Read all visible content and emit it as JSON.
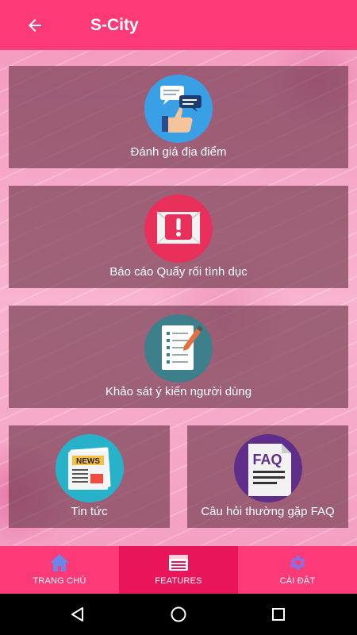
{
  "app_bar": {
    "title": "S-City"
  },
  "cards": {
    "rate": {
      "label": "Đánh giá địa điểm"
    },
    "report": {
      "label": "Báo cáo Quấy rối tình dục"
    },
    "survey": {
      "label": "Khảo sát ý kiến người dùng"
    },
    "news": {
      "label": "Tin tức",
      "badge": "NEWS"
    },
    "faq": {
      "label": "Câu hỏi thường gặp FAQ",
      "badge": "FAQ"
    }
  },
  "bottom_nav": {
    "home": "TRANG CHỦ",
    "features": "FEATURES",
    "settings": "CÀI ĐẶT",
    "active": "features"
  },
  "colors": {
    "accent": "#fc3a78",
    "active_tab": "#e8155a",
    "card_overlay": "#733c50"
  },
  "icons": [
    "back-arrow-icon",
    "chat-thumbs-up-icon",
    "alert-mail-icon",
    "survey-checklist-icon",
    "newspaper-icon",
    "faq-document-icon",
    "home-icon",
    "features-list-icon",
    "gear-icon",
    "back-triangle-icon",
    "home-circle-icon",
    "recents-square-icon"
  ]
}
